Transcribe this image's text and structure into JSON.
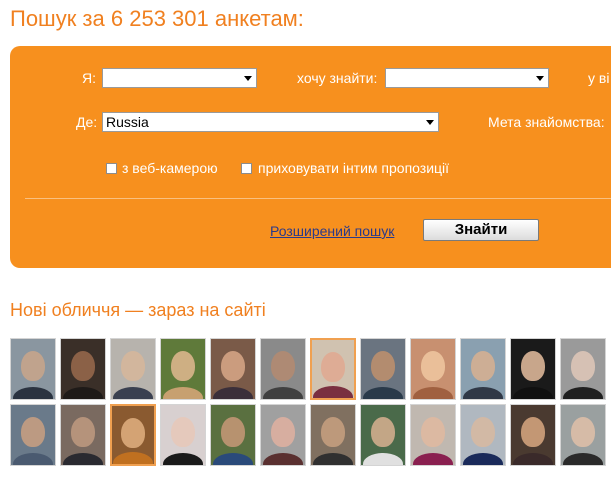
{
  "header": {
    "title": "Пошук за 6 253 301 анкетам:"
  },
  "search": {
    "i_label": "Я:",
    "i_value": "",
    "want_label": "хочу знайти:",
    "want_value": "",
    "age_label": "у ві",
    "where_label": "Де:",
    "where_value": "Russia",
    "goal_label": "Мета знайомства:",
    "webcam_label": "з веб-камерою",
    "hide_label": "приховувати інтим пропозиції",
    "webcam_checked": false,
    "hide_checked": false,
    "advanced_link": "Розширений пошук",
    "find_button": "Знайти"
  },
  "new_faces": {
    "title": "Нові обличчя — зараз на сайті",
    "photos": [
      {
        "bg": "#8a96a0",
        "face": "#c9a68a",
        "body": "#2b3340",
        "highlight": false
      },
      {
        "bg": "#3a2f28",
        "face": "#9a6a4c",
        "body": "#1e1a18",
        "highlight": false
      },
      {
        "bg": "#b7b3ad",
        "face": "#d7b69a",
        "body": "#3a4050",
        "highlight": false
      },
      {
        "bg": "#5f7a3a",
        "face": "#e2b890",
        "body": "#c7a070",
        "highlight": false
      },
      {
        "bg": "#7a5a48",
        "face": "#d9a888",
        "body": "#3b2f3a",
        "highlight": false
      },
      {
        "bg": "#8a8a8a",
        "face": "#b48a70",
        "body": "#404040",
        "highlight": false
      },
      {
        "bg": "#d0c2b0",
        "face": "#e0a890",
        "body": "#7a3040",
        "highlight": true
      },
      {
        "bg": "#6a7480",
        "face": "#c0906c",
        "body": "#2a3a4a",
        "highlight": false
      },
      {
        "bg": "#c89070",
        "face": "#f0c8a0",
        "body": "#a06040",
        "highlight": false
      },
      {
        "bg": "#8aa0b0",
        "face": "#d8b090",
        "body": "#303846",
        "highlight": false
      },
      {
        "bg": "#1a1a1a",
        "face": "#e8c0a0",
        "body": "#101010",
        "highlight": false
      },
      {
        "bg": "#9a9a9a",
        "face": "#e0c8b8",
        "body": "#202020",
        "highlight": false
      },
      {
        "bg": "#6a7a8a",
        "face": "#caa080",
        "body": "#4a5a70",
        "highlight": false
      },
      {
        "bg": "#7a6a60",
        "face": "#c09a80",
        "body": "#2a2a30",
        "highlight": false
      },
      {
        "bg": "#8a5a30",
        "face": "#e0b080",
        "body": "#c07020",
        "highlight": true
      },
      {
        "bg": "#d8d0d0",
        "face": "#e8c8b8",
        "body": "#1a1a1a",
        "highlight": false
      },
      {
        "bg": "#5a7040",
        "face": "#c89878",
        "body": "#2a4a7a",
        "highlight": false
      },
      {
        "bg": "#a0a0a0",
        "face": "#e0b0a0",
        "body": "#5a3030",
        "highlight": false
      },
      {
        "bg": "#807060",
        "face": "#c8a080",
        "body": "#303030",
        "highlight": false
      },
      {
        "bg": "#4a6a4a",
        "face": "#d8b090",
        "body": "#e0e0e0",
        "highlight": false
      },
      {
        "bg": "#c0b8b0",
        "face": "#e0b8a0",
        "body": "#8a2050",
        "highlight": false
      },
      {
        "bg": "#b0b8c0",
        "face": "#d8b8a0",
        "body": "#1a2a5a",
        "highlight": false
      },
      {
        "bg": "#4a3a30",
        "face": "#d8a880",
        "body": "#3a2a2a",
        "highlight": false
      },
      {
        "bg": "#9aa0a0",
        "face": "#e0c0a8",
        "body": "#2a2a2a",
        "highlight": false
      }
    ]
  }
}
